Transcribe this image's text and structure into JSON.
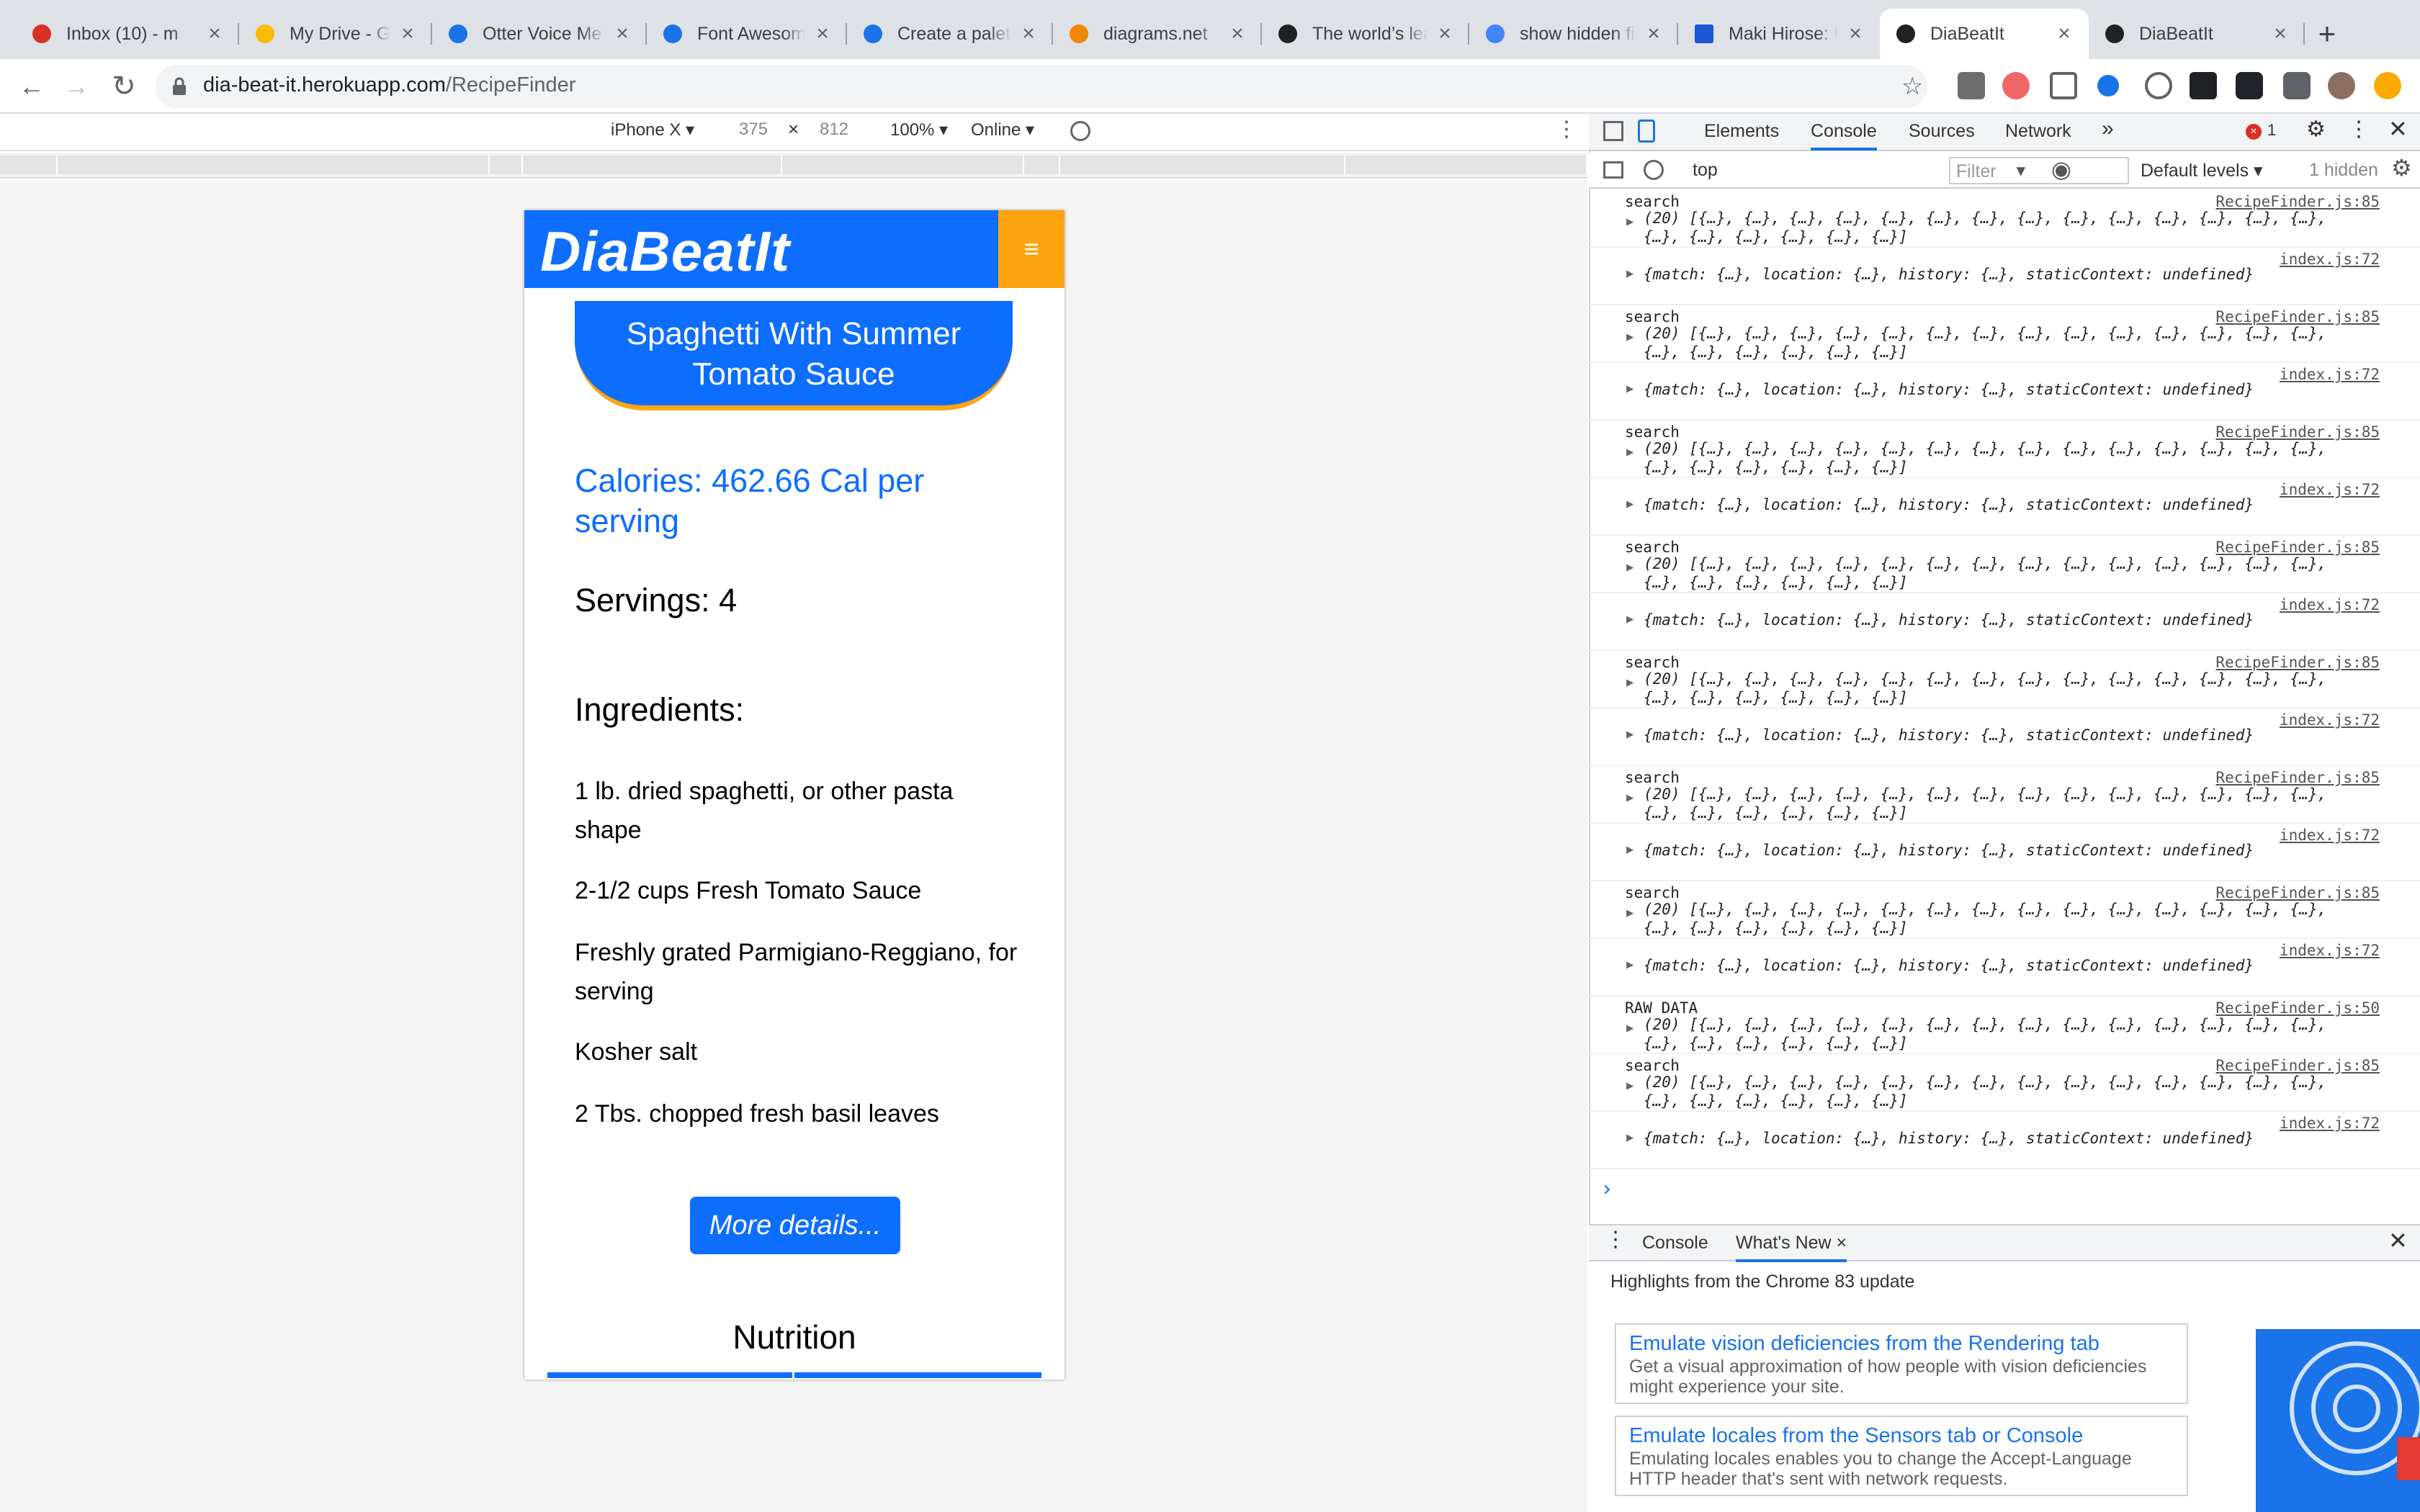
{
  "tabs": [
    {
      "title": "Inbox (10) - m",
      "icon": "gmail-icon",
      "color": "#d93025"
    },
    {
      "title": "My Drive - Goo",
      "icon": "drive-icon",
      "color": "#fbbc04"
    },
    {
      "title": "Otter Voice Me",
      "icon": "otter-icon",
      "color": "#1a73e8"
    },
    {
      "title": "Font Awesome",
      "icon": "flag-icon",
      "color": "#1a73e8"
    },
    {
      "title": "Create a palett",
      "icon": "coolors-icon",
      "color": "#1a73e8"
    },
    {
      "title": "diagrams.net",
      "icon": "diagrams-icon",
      "color": "#f08705"
    },
    {
      "title": "The world’s lea",
      "icon": "github-icon",
      "color": "#202124"
    },
    {
      "title": "show hidden fi",
      "icon": "google-icon",
      "color": "#4285f4"
    },
    {
      "title": "Maki Hirose: U",
      "icon": "square-icon",
      "color": "#1a56d6"
    },
    {
      "title": "DiaBeatIt",
      "icon": "react-icon",
      "color": "#222"
    },
    {
      "title": "DiaBeatIt",
      "icon": "react-icon",
      "color": "#222"
    }
  ],
  "address": {
    "host": "dia-beat-it.herokuapp.com",
    "path": "/RecipeFinder"
  },
  "device": {
    "name": "iPhone X ▾",
    "width": "375",
    "height": "812",
    "zoom": "100% ▾",
    "network": "Online ▾"
  },
  "app": {
    "brand": "DiaBeatIt",
    "menu_glyph": "≡",
    "recipe_title": "Spaghetti With Summer Tomato Sauce",
    "calories": "Calories: 462.66 Cal per serving",
    "servings": "Servings: 4",
    "ingredients_title": "Ingredients:",
    "ingredients": [
      "1 lb. dried spaghetti, or other pasta shape",
      "2-1/2 cups Fresh Tomato Sauce",
      "Freshly grated Parmigiano-Reggiano, for serving",
      "Kosher salt",
      "2 Tbs. chopped fresh basil leaves"
    ],
    "more_button": "More details...",
    "nutrition_title": "Nutrition",
    "brand_blue": "#0d6efd",
    "brand_orange": "#fca510"
  },
  "devtools": {
    "tabs": [
      "Elements",
      "Console",
      "Sources",
      "Network",
      "»"
    ],
    "active_tab": "Console",
    "error_count": "1",
    "context": "top",
    "filter_placeholder": "Filter",
    "levels": "Default levels ▾",
    "hidden": "1 hidden",
    "logs": [
      {
        "label": "search",
        "src": "RecipeFinder.js:85",
        "body": "(20) [{…}, {…}, {…}, {…}, {…}, {…}, {…}, {…}, {…}, {…}, {…}, {…}, {…}, {…},\n{…}, {…}, {…}, {…}, {…}, {…}]"
      },
      {
        "label": "",
        "src": "index.js:72",
        "body": "{match: {…}, location: {…}, history: {…}, staticContext: undefined}"
      },
      {
        "label": "search",
        "src": "RecipeFinder.js:85",
        "body": "(20) [{…}, {…}, {…}, {…}, {…}, {…}, {…}, {…}, {…}, {…}, {…}, {…}, {…}, {…},\n{…}, {…}, {…}, {…}, {…}, {…}]"
      },
      {
        "label": "",
        "src": "index.js:72",
        "body": "{match: {…}, location: {…}, history: {…}, staticContext: undefined}"
      },
      {
        "label": "search",
        "src": "RecipeFinder.js:85",
        "body": "(20) [{…}, {…}, {…}, {…}, {…}, {…}, {…}, {…}, {…}, {…}, {…}, {…}, {…}, {…},\n{…}, {…}, {…}, {…}, {…}, {…}]"
      },
      {
        "label": "",
        "src": "index.js:72",
        "body": "{match: {…}, location: {…}, history: {…}, staticContext: undefined}"
      },
      {
        "label": "search",
        "src": "RecipeFinder.js:85",
        "body": "(20) [{…}, {…}, {…}, {…}, {…}, {…}, {…}, {…}, {…}, {…}, {…}, {…}, {…}, {…},\n{…}, {…}, {…}, {…}, {…}, {…}]"
      },
      {
        "label": "",
        "src": "index.js:72",
        "body": "{match: {…}, location: {…}, history: {…}, staticContext: undefined}"
      },
      {
        "label": "search",
        "src": "RecipeFinder.js:85",
        "body": "(20) [{…}, {…}, {…}, {…}, {…}, {…}, {…}, {…}, {…}, {…}, {…}, {…}, {…}, {…},\n{…}, {…}, {…}, {…}, {…}, {…}]"
      },
      {
        "label": "",
        "src": "index.js:72",
        "body": "{match: {…}, location: {…}, history: {…}, staticContext: undefined}"
      },
      {
        "label": "search",
        "src": "RecipeFinder.js:85",
        "body": "(20) [{…}, {…}, {…}, {…}, {…}, {…}, {…}, {…}, {…}, {…}, {…}, {…}, {…}, {…},\n{…}, {…}, {…}, {…}, {…}, {…}]"
      },
      {
        "label": "",
        "src": "index.js:72",
        "body": "{match: {…}, location: {…}, history: {…}, staticContext: undefined}"
      },
      {
        "label": "search",
        "src": "RecipeFinder.js:85",
        "body": "(20) [{…}, {…}, {…}, {…}, {…}, {…}, {…}, {…}, {…}, {…}, {…}, {…}, {…}, {…},\n{…}, {…}, {…}, {…}, {…}, {…}]"
      },
      {
        "label": "",
        "src": "index.js:72",
        "body": "{match: {…}, location: {…}, history: {…}, staticContext: undefined}"
      },
      {
        "label": "RAW DATA",
        "src": "RecipeFinder.js:50",
        "body": "(20) [{…}, {…}, {…}, {…}, {…}, {…}, {…}, {…}, {…}, {…}, {…}, {…}, {…}, {…},\n{…}, {…}, {…}, {…}, {…}, {…}]"
      },
      {
        "label": "search",
        "src": "RecipeFinder.js:85",
        "body": "(20) [{…}, {…}, {…}, {…}, {…}, {…}, {…}, {…}, {…}, {…}, {…}, {…}, {…}, {…},\n{…}, {…}, {…}, {…}, {…}, {…}]"
      },
      {
        "label": "",
        "src": "index.js:72",
        "body": "{match: {…}, location: {…}, history: {…}, staticContext: undefined}"
      }
    ],
    "prompt": "›",
    "drawer_tabs": [
      "Console",
      "What's New"
    ],
    "highlights": "Highlights from the Chrome 83 update",
    "cards": [
      {
        "title": "Emulate vision deficiencies from the Rendering tab",
        "desc": "Get a visual approximation of how people with vision deficiencies might experience your site."
      },
      {
        "title": "Emulate locales from the Sensors tab or Console",
        "desc": "Emulating locales enables you to change the Accept-Language HTTP header that's sent with network requests."
      }
    ]
  }
}
